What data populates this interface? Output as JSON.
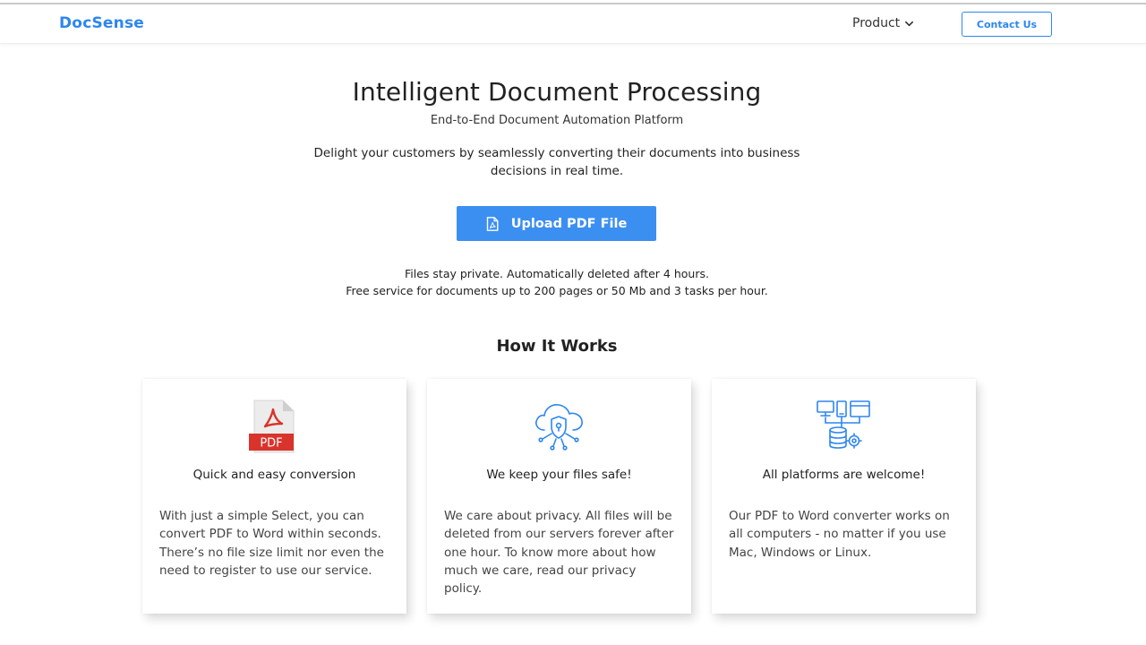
{
  "nav": {
    "brand": "DocSense",
    "product_label": "Product",
    "contact_label": "Contact Us"
  },
  "hero": {
    "title": "Intelligent Document Processing",
    "subtitle": "End-to-End Document Automation Platform",
    "description": "Delight your customers by seamlessly converting their documents into business decisions in real time.",
    "upload_label": "Upload PDF File",
    "note_line1": "Files stay private. Automatically deleted after 4 hours.",
    "note_line2": "Free service for documents up to 200 pages or 50 Mb and 3 tasks per hour."
  },
  "how_it_works": {
    "title": "How It Works",
    "cards": [
      {
        "icon": "pdf-file-icon",
        "icon_label": "PDF",
        "title": "Quick and easy conversion",
        "text": "With just a simple Select, you can convert PDF to Word within seconds. There’s no file size limit nor even the need to register to use our service."
      },
      {
        "icon": "cloud-shield-icon",
        "title": "We keep your files safe!",
        "text": "We care about privacy. All files will be deleted from our servers forever after one hour. To know more about how much we care, read our privacy policy."
      },
      {
        "icon": "platforms-icon",
        "title": "All platforms are welcome!",
        "text": "Our PDF to Word converter works on all computers - no matter if you use Mac, Windows or Linux."
      }
    ]
  },
  "colors": {
    "brand_blue": "#2d86ef",
    "button_blue": "#3b8ff0",
    "pdf_red": "#d9342b"
  }
}
